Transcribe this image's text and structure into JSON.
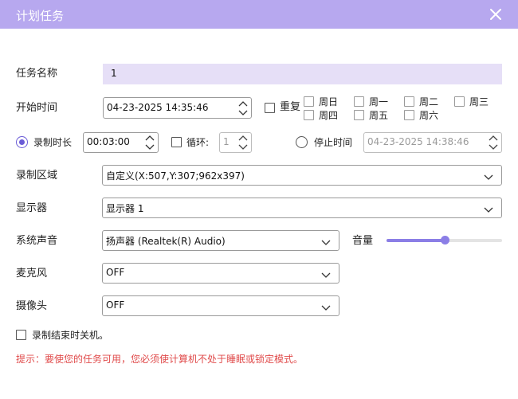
{
  "window": {
    "title": "计划任务"
  },
  "colors": {
    "accent": "#b7a8ef",
    "slider": "#8b7ee6",
    "hint": "#e04b4b"
  },
  "icons": {
    "close": "close-icon",
    "spin": "spin-updown-icon",
    "dropdown": "chevron-down-icon"
  },
  "task_name": {
    "label": "任务名称",
    "value": "1"
  },
  "start_time": {
    "label": "开始时间",
    "value": "04-23-2025 14:35:46"
  },
  "repeat": {
    "label": "重复",
    "checked": false,
    "days": [
      "周日",
      "周一",
      "周二",
      "周三",
      "周四",
      "周五",
      "周六"
    ]
  },
  "duration": {
    "label": "录制时长",
    "selected": true,
    "value": "00:03:00"
  },
  "loop": {
    "label": "循环:",
    "checked": false,
    "value": "1"
  },
  "stop_time": {
    "label": "停止时间",
    "selected": false,
    "value": "04-23-2025 14:38:46"
  },
  "region": {
    "label": "录制区域",
    "value": "自定义(X:507,Y:307;962x397)"
  },
  "display": {
    "label": "显示器",
    "value": "显示器 1"
  },
  "system_audio": {
    "label": "系统声音",
    "value": "扬声器 (Realtek(R) Audio)"
  },
  "volume": {
    "label": "音量",
    "level_percent": 50
  },
  "microphone": {
    "label": "麦克风",
    "value": "OFF"
  },
  "camera": {
    "label": "摄像头",
    "value": "OFF"
  },
  "shutdown": {
    "label": "录制结束时关机。",
    "checked": false
  },
  "hint": {
    "text": "提示：要使您的任务可用，您必须使计算机不处于睡眠或锁定模式。"
  }
}
